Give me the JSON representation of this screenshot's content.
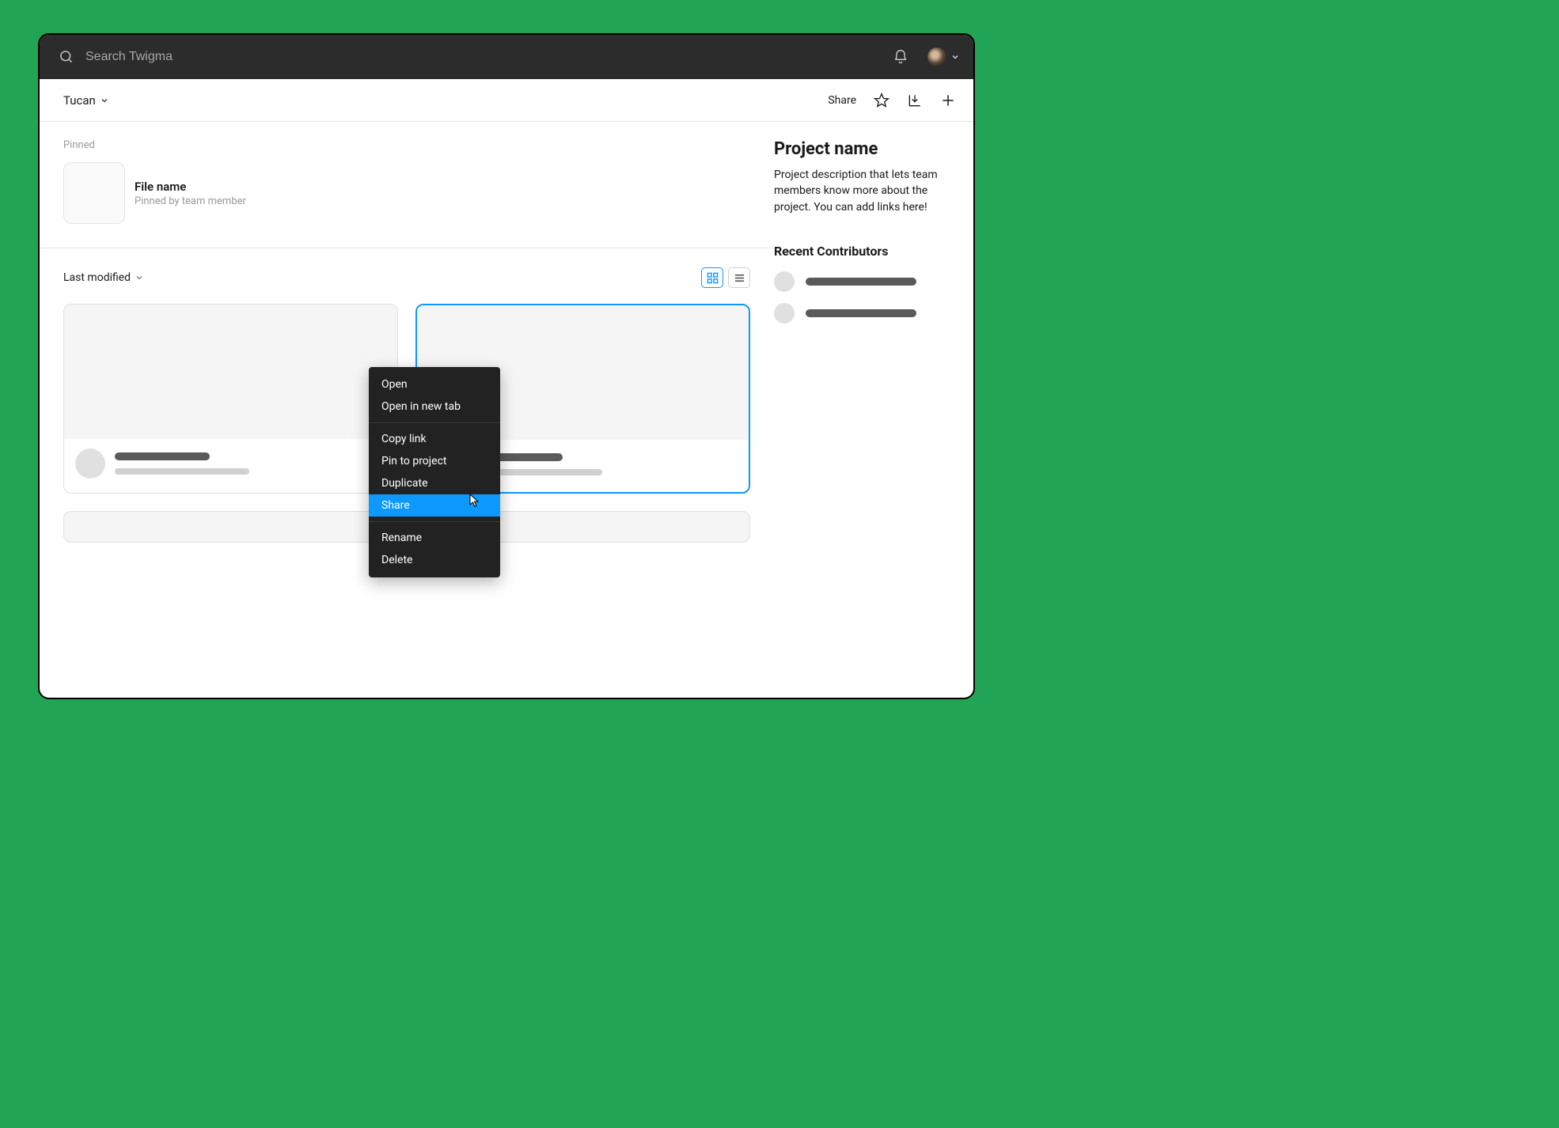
{
  "topbar": {
    "search_placeholder": "Search Twigma"
  },
  "subheader": {
    "workspace_name": "Tucan",
    "share_label": "Share"
  },
  "pinned": {
    "section_label": "Pinned",
    "file_name": "File name",
    "pinned_by": "Pinned by team member"
  },
  "files": {
    "sort_label": "Last modified"
  },
  "sidebar": {
    "project_title": "Project name",
    "project_desc": "Project description that lets team members know more about the project. You can add links here!",
    "contributors_title": "Recent Contributors"
  },
  "context_menu": {
    "items": [
      {
        "label": "Open"
      },
      {
        "label": "Open in new tab"
      }
    ],
    "items2": [
      {
        "label": "Copy link"
      },
      {
        "label": "Pin to project"
      },
      {
        "label": "Duplicate"
      },
      {
        "label": "Share",
        "highlighted": true
      }
    ],
    "items3": [
      {
        "label": "Rename"
      },
      {
        "label": "Delete"
      }
    ]
  }
}
